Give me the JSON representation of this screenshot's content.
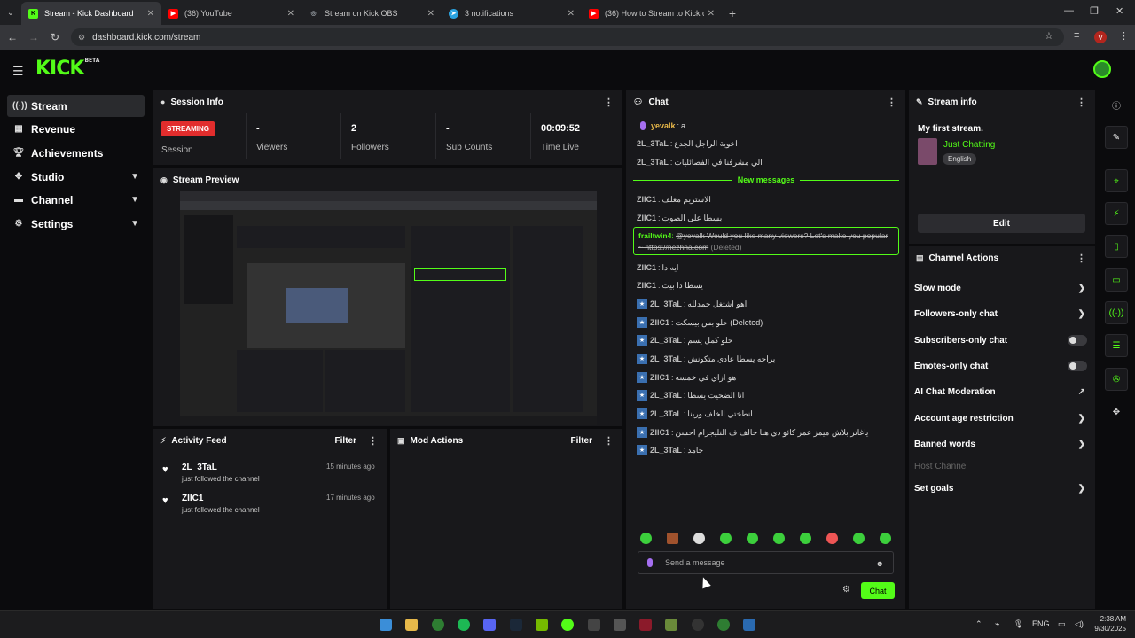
{
  "browser": {
    "tabs": [
      {
        "title": "Stream - Kick Dashboard",
        "favicon": "kick-icon",
        "color": "#53fc18",
        "active": true
      },
      {
        "title": "(36) YouTube",
        "favicon": "youtube-icon",
        "color": "#ff0000",
        "active": false
      },
      {
        "title": "Stream on Kick OBS",
        "favicon": "globe-icon",
        "color": "#9aa0a6",
        "active": false
      },
      {
        "title": "3 notifications",
        "favicon": "telegram-icon",
        "color": "#2aa3e0",
        "active": false
      },
      {
        "title": "(36) How to Stream to Kick on ...",
        "favicon": "youtube-icon",
        "color": "#ff0000",
        "active": false
      }
    ],
    "url": "dashboard.kick.com/stream",
    "profile_initial": "V"
  },
  "app": {
    "logo": "KICK",
    "logo_sup": "BETA"
  },
  "sidebar": {
    "items": [
      {
        "label": "Stream",
        "icon": "stream-icon",
        "selected": true
      },
      {
        "label": "Revenue",
        "icon": "revenue-icon"
      },
      {
        "label": "Achievements",
        "icon": "trophy-icon"
      },
      {
        "label": "Studio",
        "icon": "studio-icon",
        "expandable": true
      },
      {
        "label": "Channel",
        "icon": "channel-icon",
        "expandable": true
      },
      {
        "label": "Settings",
        "icon": "settings-icon",
        "expandable": true
      }
    ]
  },
  "session": {
    "title": "Session Info",
    "status": "STREAMING",
    "status_label": "Session",
    "viewers": {
      "value": "-",
      "label": "Viewers"
    },
    "followers": {
      "value": "2",
      "label": "Followers"
    },
    "subs": {
      "value": "-",
      "label": "Sub Counts"
    },
    "time": {
      "value": "00:09:52",
      "label": "Time Live"
    }
  },
  "preview": {
    "title": "Stream Preview"
  },
  "activity": {
    "title": "Activity Feed",
    "filter": "Filter",
    "items": [
      {
        "name": "2L_3TaL",
        "text": "just followed the channel",
        "ago": "15 minutes ago"
      },
      {
        "name": "ZIlC1",
        "text": "just followed the channel",
        "ago": "17 minutes ago"
      }
    ]
  },
  "mod": {
    "title": "Mod Actions",
    "filter": "Filter"
  },
  "chat": {
    "title": "Chat",
    "new_messages": "New messages",
    "messages": [
      {
        "user": "yevalk",
        "text": "a",
        "badge": false,
        "user_color": "#e9b949"
      },
      {
        "user": "2L_3TaL",
        "text": "اخوية الراجل الجدع",
        "badge": false
      },
      {
        "user": "2L_3TaL",
        "text": "الي مشرفنا في الفصائليات",
        "badge": false
      },
      {
        "user": "ZIlC1",
        "text": "الاستريم معلف",
        "badge": false
      },
      {
        "user": "ZIlC1",
        "text": "يسطا على الصوت",
        "badge": false
      },
      {
        "user": "ZIlC1",
        "text": "ايه دا",
        "badge": false
      },
      {
        "user": "ZIlC1",
        "text": "يسطا دا بيت",
        "badge": false
      },
      {
        "user": "2L_3TaL",
        "text": "اهو اشتغل حمدلله",
        "badge": true
      },
      {
        "user": "ZIlC1",
        "text": "حلو بس بيسكت (Deleted)",
        "badge": true
      },
      {
        "user": "2L_3TaL",
        "text": "حلو كمل يسم",
        "badge": true
      },
      {
        "user": "2L_3TaL",
        "text": "براحه يسطا عادي متكونش",
        "badge": true
      },
      {
        "user": "ZIlC1",
        "text": "هو ازاي في خمسه",
        "badge": true
      },
      {
        "user": "2L_3TaL",
        "text": "انا الضحيت يسطا",
        "badge": true
      },
      {
        "user": "2L_3TaL",
        "text": "انطختي الخلف ورينا",
        "badge": true
      },
      {
        "user": "ZIlC1",
        "text": "ياغاتر بلاش ميمز عمر كائو دي هنا حالف ف التليجرام احسن",
        "badge": true
      },
      {
        "user": "2L_3TaL",
        "text": "جامد",
        "badge": true
      }
    ],
    "highlight": {
      "user": "frailtwin4",
      "text": "@yevalk Would you like many viewers? Let's make you popular ~ https://nezhna.com",
      "deleted": "(Deleted)"
    },
    "placeholder": "Send a message",
    "send": "Chat"
  },
  "stream_info": {
    "title": "Stream info",
    "stream_title": "My first stream.",
    "category": "Just Chatting",
    "language": "English",
    "edit": "Edit"
  },
  "channel_actions": {
    "title": "Channel Actions",
    "items": [
      {
        "label": "Slow mode",
        "control": "chevron"
      },
      {
        "label": "Followers-only chat",
        "control": "chevron"
      },
      {
        "label": "Subscribers-only chat",
        "control": "toggle"
      },
      {
        "label": "Emotes-only chat",
        "control": "toggle"
      },
      {
        "label": "AI Chat Moderation",
        "control": "external"
      },
      {
        "label": "Account age restriction",
        "control": "chevron"
      },
      {
        "label": "Banned words",
        "control": "chevron"
      },
      {
        "label": "Host Channel",
        "control": "none",
        "disabled": true
      },
      {
        "label": "Set goals",
        "control": "chevron"
      }
    ]
  },
  "taskbar": {
    "lang": "ENG",
    "time": "2:38 AM",
    "date": "9/30/2025"
  }
}
